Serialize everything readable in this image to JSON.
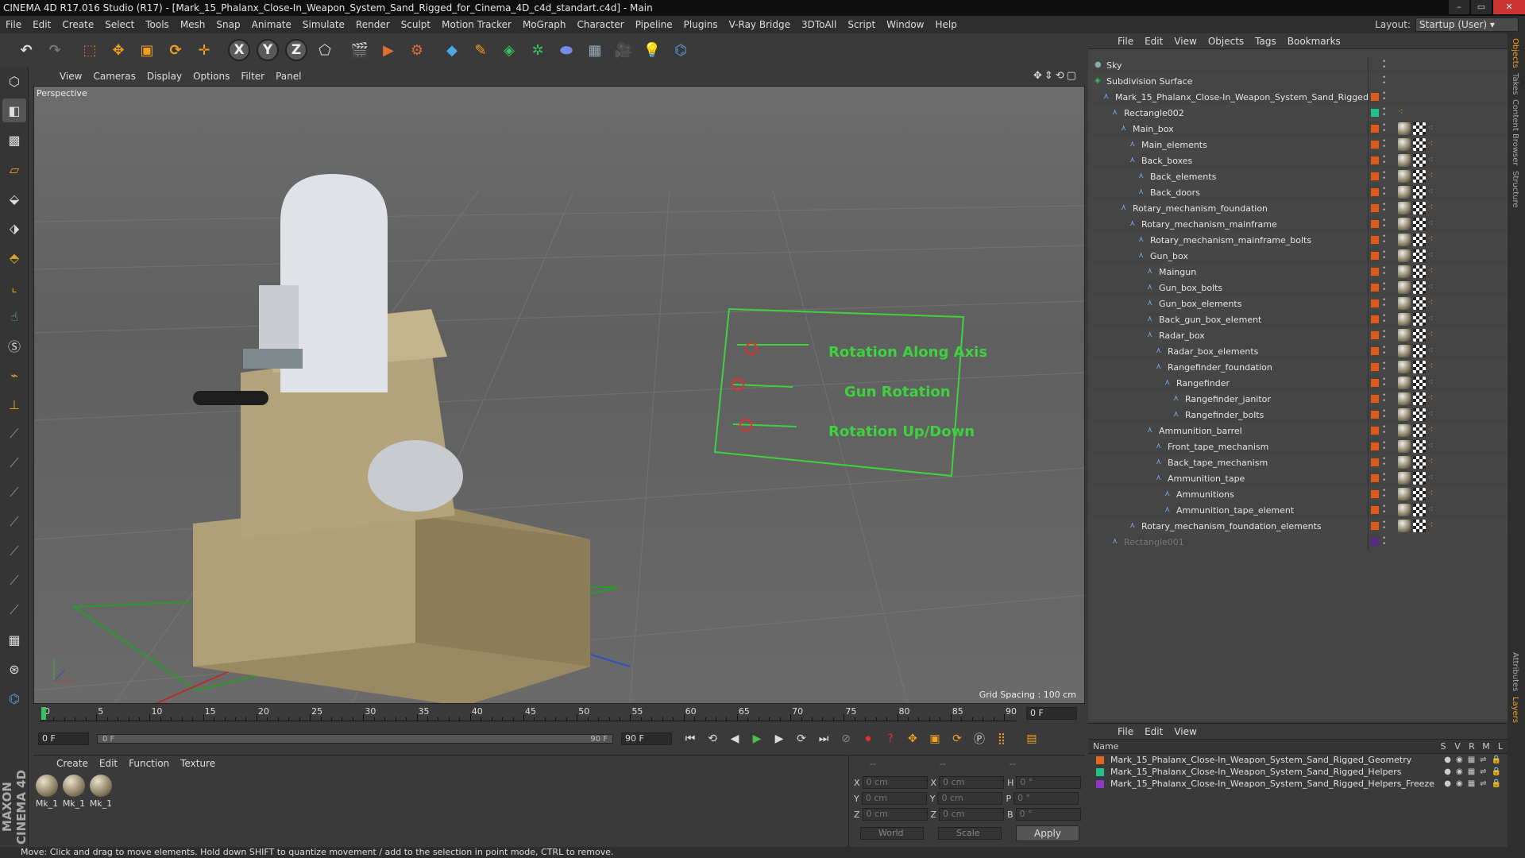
{
  "window": {
    "title": "CINEMA 4D R17.016 Studio (R17) - [Mark_15_Phalanx_Close-In_Weapon_System_Sand_Rigged_for_Cinema_4D_c4d_standart.c4d] - Main"
  },
  "menubar": {
    "items": [
      "File",
      "Edit",
      "Create",
      "Select",
      "Tools",
      "Mesh",
      "Snap",
      "Animate",
      "Simulate",
      "Render",
      "Sculpt",
      "Motion Tracker",
      "MoGraph",
      "Character",
      "Pipeline",
      "Plugins",
      "V-Ray Bridge",
      "3DToAll",
      "Script",
      "Window",
      "Help"
    ]
  },
  "layout": {
    "label": "Layout:",
    "value": "Startup (User)"
  },
  "viewport": {
    "menu": [
      "View",
      "Cameras",
      "Display",
      "Options",
      "Filter",
      "Panel"
    ],
    "label": "Perspective",
    "grid_spacing": "Grid Spacing : 100 cm",
    "rig_labels": [
      "Rotation Along Axis",
      "Gun Rotation",
      "Rotation Up/Down"
    ]
  },
  "timeline": {
    "ticks": [
      "0",
      "5",
      "10",
      "15",
      "20",
      "25",
      "30",
      "35",
      "40",
      "45",
      "50",
      "55",
      "60",
      "65",
      "70",
      "75",
      "80",
      "85",
      "90"
    ],
    "current_frame": "0 F",
    "start_field": "0 F",
    "slider_start": "0 F",
    "slider_end": "90 F",
    "end_field": "90 F"
  },
  "materials": {
    "menu": [
      "Create",
      "Edit",
      "Function",
      "Texture"
    ],
    "items": [
      "Mk_1",
      "Mk_1",
      "Mk_1"
    ]
  },
  "coordinates": {
    "header": [
      "--",
      "--",
      "--"
    ],
    "rows": [
      {
        "axis": "X",
        "pos": "0 cm",
        "axis2": "X",
        "size": "0 cm",
        "axis3": "H",
        "rot": "0 °"
      },
      {
        "axis": "Y",
        "pos": "0 cm",
        "axis2": "Y",
        "size": "0 cm",
        "axis3": "P",
        "rot": "0 °"
      },
      {
        "axis": "Z",
        "pos": "0 cm",
        "axis2": "Z",
        "size": "0 cm",
        "axis3": "B",
        "rot": "0 °"
      }
    ],
    "mode1": "World",
    "mode2": "Scale",
    "apply": "Apply"
  },
  "object_manager": {
    "menu": [
      "File",
      "Edit",
      "View",
      "Objects",
      "Tags",
      "Bookmarks"
    ],
    "objects": [
      {
        "name": "Sky",
        "depth": 0
      },
      {
        "name": "Subdivision Surface",
        "depth": 0
      },
      {
        "name": "Mark_15_Phalanx_Close-In_Weapon_System_Sand_Rigged",
        "depth": 1
      },
      {
        "name": "Rectangle002",
        "depth": 2
      },
      {
        "name": "Main_box",
        "depth": 3
      },
      {
        "name": "Main_elements",
        "depth": 4
      },
      {
        "name": "Back_boxes",
        "depth": 4
      },
      {
        "name": "Back_elements",
        "depth": 5
      },
      {
        "name": "Back_doors",
        "depth": 5
      },
      {
        "name": "Rotary_mechanism_foundation",
        "depth": 3
      },
      {
        "name": "Rotary_mechanism_mainframe",
        "depth": 4
      },
      {
        "name": "Rotary_mechanism_mainframe_bolts",
        "depth": 5
      },
      {
        "name": "Gun_box",
        "depth": 5
      },
      {
        "name": "Maingun",
        "depth": 6
      },
      {
        "name": "Gun_box_bolts",
        "depth": 6
      },
      {
        "name": "Gun_box_elements",
        "depth": 6
      },
      {
        "name": "Back_gun_box_element",
        "depth": 6
      },
      {
        "name": "Radar_box",
        "depth": 6
      },
      {
        "name": "Radar_box_elements",
        "depth": 7
      },
      {
        "name": "Rangefinder_foundation",
        "depth": 7
      },
      {
        "name": "Rangefinder",
        "depth": 8
      },
      {
        "name": "Rangefinder_janitor",
        "depth": 9
      },
      {
        "name": "Rangefinder_bolts",
        "depth": 9
      },
      {
        "name": "Ammunition_barrel",
        "depth": 6
      },
      {
        "name": "Front_tape_mechanism",
        "depth": 7
      },
      {
        "name": "Back_tape_mechanism",
        "depth": 7
      },
      {
        "name": "Ammunition_tape",
        "depth": 7
      },
      {
        "name": "Ammunitions",
        "depth": 8
      },
      {
        "name": "Ammunition_tape_element",
        "depth": 8
      },
      {
        "name": "Rotary_mechanism_foundation_elements",
        "depth": 4
      },
      {
        "name": "Rectangle001",
        "depth": 2
      }
    ]
  },
  "layer_manager": {
    "menu": [
      "File",
      "Edit",
      "View"
    ],
    "columns": [
      "Name",
      "S",
      "V",
      "R",
      "M",
      "L"
    ],
    "layers": [
      {
        "name": "Mark_15_Phalanx_Close-In_Weapon_System_Sand_Rigged_Geometry",
        "color": "#e06a1e"
      },
      {
        "name": "Mark_15_Phalanx_Close-In_Weapon_System_Sand_Rigged_Helpers",
        "color": "#22c08a"
      },
      {
        "name": "Mark_15_Phalanx_Close-In_Weapon_System_Sand_Rigged_Helpers_Freeze",
        "color": "#8a3ac0"
      }
    ]
  },
  "right_tabs": [
    "Objects",
    "Takes",
    "Content Browser",
    "Structure",
    "Attributes",
    "Layers"
  ],
  "status": {
    "text": "Move: Click and drag to move elements. Hold down SHIFT to quantize movement / add to the selection in point mode, CTRL to remove."
  },
  "brand": {
    "text": "MAXON CINEMA 4D"
  }
}
